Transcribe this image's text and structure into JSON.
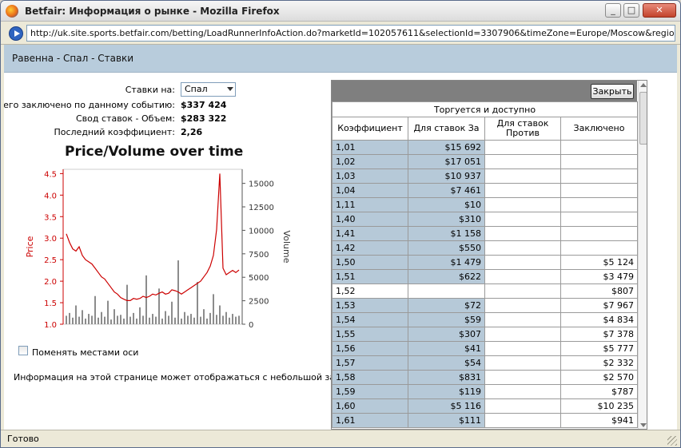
{
  "window": {
    "title": "Betfair: Информация о рынке - Mozilla Firefox",
    "url": "http://uk.site.sports.betfair.com/betting/LoadRunnerInfoAction.do?marketId=102057611&selectionId=3307906&timeZone=Europe/Moscow&region=GBR&locale="
  },
  "page": {
    "title": "Равенна - Спал - Ставки",
    "bets_on_label": "Ставки на:",
    "bets_on_value": "Спал",
    "total_matched_label": "Всего заключено по данному событию:",
    "total_matched_value": "$337 424",
    "volume_label": "Свод ставок - Объем:",
    "volume_value": "$283 322",
    "last_odds_label": "Последний коэффициент:",
    "last_odds_value": "2,26",
    "swap_axes_label": "Поменять местами оси",
    "notice": "Информация на этой странице может отображаться с небольшой задержкой."
  },
  "chart_data": {
    "type": "line",
    "title": "Price/Volume over time",
    "ylabel": "Price",
    "y2label": "Volume",
    "ylim": [
      1.0,
      4.6
    ],
    "y2lim": [
      0,
      16500
    ],
    "yticks": [
      "1.0",
      "1.5",
      "2.0",
      "2.5",
      "3.0",
      "3.5",
      "4.0",
      "4.5"
    ],
    "y2ticks": [
      "0",
      "2500",
      "5000",
      "7500",
      "10000",
      "12500",
      "15000"
    ],
    "series": [
      {
        "name": "Price",
        "color": "#cc0000",
        "values": [
          3.1,
          2.9,
          2.75,
          2.7,
          2.8,
          2.6,
          2.5,
          2.45,
          2.4,
          2.3,
          2.2,
          2.1,
          2.05,
          1.95,
          1.85,
          1.75,
          1.7,
          1.62,
          1.58,
          1.55,
          1.55,
          1.6,
          1.58,
          1.6,
          1.65,
          1.62,
          1.65,
          1.7,
          1.68,
          1.72,
          1.75,
          1.7,
          1.72,
          1.8,
          1.78,
          1.75,
          1.7,
          1.75,
          1.8,
          1.85,
          1.9,
          1.95,
          2.0,
          2.1,
          2.2,
          2.35,
          2.6,
          3.2,
          4.5,
          2.3,
          2.15,
          2.2,
          2.25,
          2.2,
          2.26
        ]
      },
      {
        "name": "Volume",
        "axis": "right",
        "color": "#8c8c8c",
        "values": [
          900,
          1200,
          700,
          2000,
          800,
          1500,
          600,
          1100,
          900,
          3000,
          700,
          1300,
          800,
          2500,
          500,
          1600,
          900,
          1000,
          600,
          4200,
          800,
          1200,
          600,
          1800,
          900,
          5200,
          700,
          1100,
          800,
          3800,
          600,
          1400,
          900,
          2400,
          700,
          6800,
          600,
          1300,
          900,
          1100,
          700,
          4500,
          800,
          1600,
          600,
          1200,
          3200,
          1000,
          2000,
          900,
          1300,
          700,
          1100,
          800,
          900
        ]
      }
    ]
  },
  "panel": {
    "close_label": "Закрыть",
    "super_header": "Торгуется и доступно",
    "headers": [
      "Коэффициент",
      "Для ставок За",
      "Для ставок Против",
      "Заключено"
    ],
    "rows": [
      [
        "1,01",
        "$15 692",
        "",
        ""
      ],
      [
        "1,02",
        "$17 051",
        "",
        ""
      ],
      [
        "1,03",
        "$10 937",
        "",
        ""
      ],
      [
        "1,04",
        "$7 461",
        "",
        ""
      ],
      [
        "1,11",
        "$10",
        "",
        ""
      ],
      [
        "1,40",
        "$310",
        "",
        ""
      ],
      [
        "1,41",
        "$1 158",
        "",
        ""
      ],
      [
        "1,42",
        "$550",
        "",
        ""
      ],
      [
        "1,50",
        "$1 479",
        "",
        "$5 124"
      ],
      [
        "1,51",
        "$622",
        "",
        "$3 479"
      ],
      [
        "1,52",
        "",
        "",
        "$807"
      ],
      [
        "1,53",
        "$72",
        "",
        "$7 967"
      ],
      [
        "1,54",
        "$59",
        "",
        "$4 834"
      ],
      [
        "1,55",
        "$307",
        "",
        "$7 378"
      ],
      [
        "1,56",
        "$41",
        "",
        "$5 777"
      ],
      [
        "1,57",
        "$54",
        "",
        "$2 332"
      ],
      [
        "1,58",
        "$831",
        "",
        "$2 570"
      ],
      [
        "1,59",
        "$119",
        "",
        "$787"
      ],
      [
        "1,60",
        "$5 116",
        "",
        "$10 235"
      ],
      [
        "1,61",
        "$111",
        "",
        "$941"
      ]
    ]
  },
  "status": {
    "text": "Готово"
  }
}
